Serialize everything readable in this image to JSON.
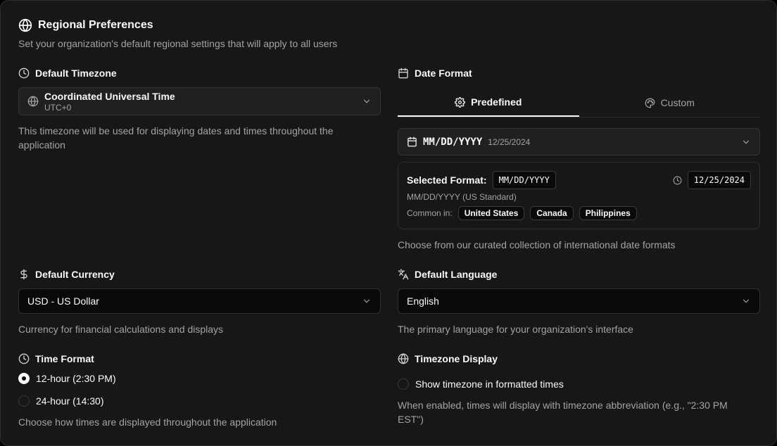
{
  "header": {
    "title": "Regional Preferences",
    "subtitle": "Set your organization's default regional settings that will apply to all users"
  },
  "timezone": {
    "label": "Default Timezone",
    "selected_name": "Coordinated Universal Time",
    "selected_offset": "UTC+0",
    "help": "This timezone will be used for displaying dates and times throughout the application"
  },
  "date_format": {
    "label": "Date Format",
    "tabs": [
      {
        "label": "Predefined",
        "active": true
      },
      {
        "label": "Custom",
        "active": false
      }
    ],
    "selected_pattern": "MM/DD/YYYY",
    "selected_example": "12/25/2024",
    "details": {
      "selected_label": "Selected Format:",
      "selected_value": "MM/DD/YYYY",
      "preview": "12/25/2024",
      "description": "MM/DD/YYYY (US Standard)",
      "common_label": "Common in:",
      "countries": [
        "United States",
        "Canada",
        "Philippines"
      ]
    },
    "help": "Choose from our curated collection of international date formats"
  },
  "currency": {
    "label": "Default Currency",
    "selected": "USD - US Dollar",
    "help": "Currency for financial calculations and displays"
  },
  "language": {
    "label": "Default Language",
    "selected": "English",
    "help": "The primary language for your organization's interface"
  },
  "time_format": {
    "label": "Time Format",
    "options": [
      {
        "label": "12-hour (2:30 PM)",
        "checked": true
      },
      {
        "label": "24-hour (14:30)",
        "checked": false
      }
    ],
    "help": "Choose how times are displayed throughout the application"
  },
  "timezone_display": {
    "label": "Timezone Display",
    "option_label": "Show timezone in formatted times",
    "checked": false,
    "help": "When enabled, times will display with timezone abbreviation (e.g., \"2:30 PM EST\")"
  },
  "icons": {
    "globe": "globe-icon",
    "clock": "clock-icon",
    "calendar": "calendar-icon",
    "dollar": "dollar-icon",
    "languages": "languages-icon",
    "gear": "gear-icon",
    "palette": "palette-icon",
    "chevron": "chevron-down-icon"
  }
}
